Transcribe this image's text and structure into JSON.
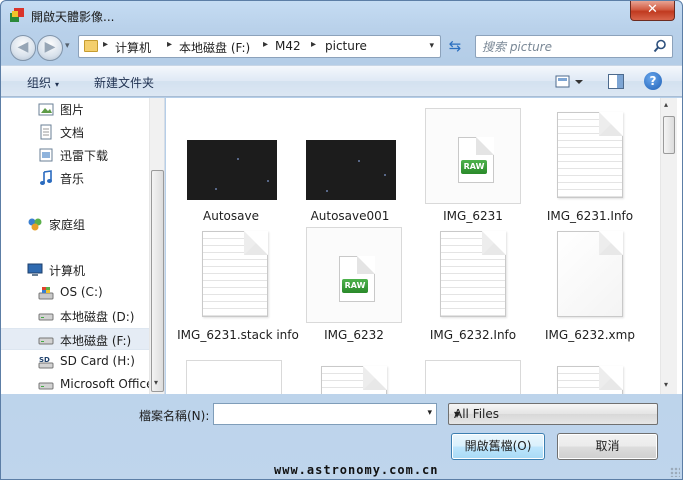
{
  "window": {
    "title": "開啟天體影像...",
    "close_glyph": "✕"
  },
  "nav": {
    "back_glyph": "◀",
    "forward_glyph": "▶",
    "history_glyph": "▾"
  },
  "address": {
    "breadcrumbs": [
      "计算机",
      "本地磁盘 (F:)",
      "M42",
      "picture"
    ],
    "separator": "▸",
    "dropdown_glyph": "▾",
    "refresh_glyph": "⇆"
  },
  "search": {
    "placeholder": "搜索 picture"
  },
  "toolbar": {
    "organize_label": "组织",
    "organize_arrow": "▾",
    "new_folder_label": "新建文件夹",
    "help_label": "?"
  },
  "sidebar": {
    "items": [
      {
        "label": "图片",
        "icon": "pictures-icon"
      },
      {
        "label": "文档",
        "icon": "documents-icon"
      },
      {
        "label": "迅雷下载",
        "icon": "download-folder-icon"
      },
      {
        "label": "音乐",
        "icon": "music-icon"
      },
      {
        "label": "家庭组",
        "icon": "homegroup-icon"
      },
      {
        "label": "计算机",
        "icon": "computer-icon"
      },
      {
        "label": "OS (C:)",
        "icon": "os-drive-icon"
      },
      {
        "label": "本地磁盘 (D:)",
        "icon": "drive-icon"
      },
      {
        "label": "本地磁盘 (F:)",
        "icon": "drive-icon",
        "selected": true
      },
      {
        "label": "SD Card (H:)",
        "icon": "sd-card-icon"
      },
      {
        "label": "Microsoft Office",
        "icon": "drive-icon"
      }
    ],
    "scroll_down_glyph": "▾"
  },
  "files": [
    {
      "name": "Autosave",
      "type": "photo"
    },
    {
      "name": "Autosave001",
      "type": "photo"
    },
    {
      "name": "IMG_6231",
      "type": "raw"
    },
    {
      "name": "IMG_6231.Info",
      "type": "doc"
    },
    {
      "name": "IMG_6231.stack info",
      "type": "doc"
    },
    {
      "name": "IMG_6232",
      "type": "raw"
    },
    {
      "name": "IMG_6232.Info",
      "type": "doc"
    },
    {
      "name": "IMG_6232.xmp",
      "type": "blank-doc"
    }
  ],
  "raw_badge": "RAW",
  "bottom": {
    "filename_label": "檔案名稱(N):",
    "filename_value": "",
    "filetype_value": "All Files",
    "dropdown_glyph": "▾",
    "open_label": "開啟舊檔(O)",
    "cancel_label": "取消"
  },
  "watermark": "www.astronomy.com.cn",
  "colors": {
    "chrome_blue": "#b9d1ea",
    "close_red": "#c03a1f",
    "raw_green": "#2a8a2a",
    "selected_row": "#e5ecf5"
  }
}
